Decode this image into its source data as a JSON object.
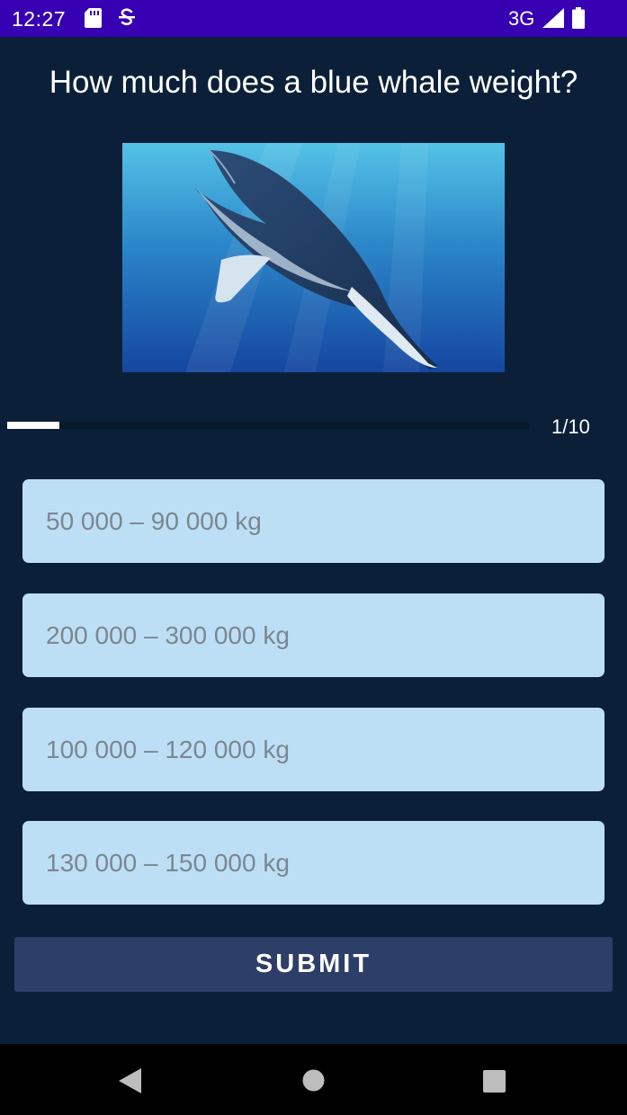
{
  "status_bar": {
    "time": "12:27",
    "network": "3G",
    "icons": [
      "sd-card-icon",
      "s-notification-icon",
      "signal-icon",
      "battery-icon"
    ]
  },
  "quiz": {
    "question": "How much does a blue whale weight?",
    "image_label": "blue-whale-photo",
    "progress": {
      "current": 1,
      "total": 10,
      "text": "1/10",
      "fraction": 0.1
    },
    "options": [
      "50 000 – 90 000 kg",
      "200 000 – 300 000 kg",
      "100 000 – 120 000 kg",
      "130 000 – 150 000 kg"
    ],
    "submit_label": "SUBMIT"
  },
  "nav_bar": {
    "icons": [
      "back-icon",
      "home-icon",
      "recents-icon"
    ]
  },
  "colors": {
    "status_bar": "#3700b3",
    "background": "#0b2038",
    "option_background": "#bddff5",
    "option_text": "#7a8791",
    "submit_background": "#2d3e68"
  }
}
